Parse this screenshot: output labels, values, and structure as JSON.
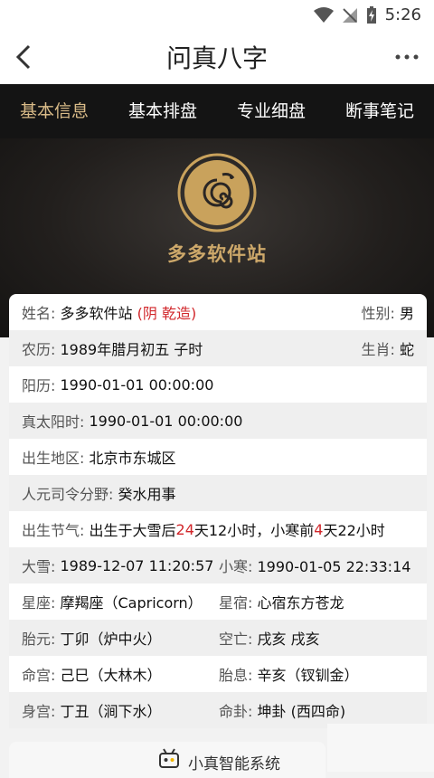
{
  "status": {
    "time": "5:26"
  },
  "header": {
    "title": "问真八字"
  },
  "tabs": [
    {
      "label": "基本信息"
    },
    {
      "label": "基本排盘"
    },
    {
      "label": "专业细盘"
    },
    {
      "label": "断事笔记"
    }
  ],
  "banner": {
    "name": "多多软件站"
  },
  "info": {
    "name_label": "姓名:",
    "name_value": "多多软件站",
    "name_note": "(阴 乾造)",
    "gender_label": "性别:",
    "gender_value": "男",
    "lunar_label": "农历:",
    "lunar_value": "1989年腊月初五 子时",
    "zodiac_label": "生肖:",
    "zodiac_value": "蛇",
    "solar_label": "阳历:",
    "solar_value": "1990-01-01 00:00:00",
    "true_solar_label": "真太阳时:",
    "true_solar_value": "1990-01-01 00:00:00",
    "place_label": "出生地区:",
    "place_value": "北京市东城区",
    "renyuan_label": "人元司令分野:",
    "renyuan_value": "癸水用事",
    "jieqi_label": "出生节气:",
    "jieqi_p1": "出生于大雪后",
    "jieqi_d1": "24",
    "jieqi_p2": "天12小时，小寒前",
    "jieqi_d2": "4",
    "jieqi_p3": "天22小时",
    "daxue_label": "大雪:",
    "daxue_value": "1989-12-07 11:20:57",
    "xiaohan_label": "小寒:",
    "xiaohan_value": "1990-01-05 22:33:14",
    "constellation_label": "星座:",
    "constellation_value": "摩羯座（Capricorn）",
    "xiuxiu_label": "星宿:",
    "xiuxiu_value": "心宿东方苍龙",
    "taiyuan_label": "胎元:",
    "taiyuan_value": "丁卯（炉中火）",
    "kongwang_label": "空亡:",
    "kongwang_value": "戌亥 戌亥",
    "minggong_label": "命宫:",
    "minggong_value": "己巳（大林木）",
    "taixi_label": "胎息:",
    "taixi_value": "辛亥（钗钏金）",
    "shengong_label": "身宫:",
    "shengong_value": "丁丑（涧下水）",
    "minggua_label": "命卦:",
    "minggua_value": "坤卦 (西四命)"
  },
  "bottom": {
    "label": "小真智能系统"
  }
}
